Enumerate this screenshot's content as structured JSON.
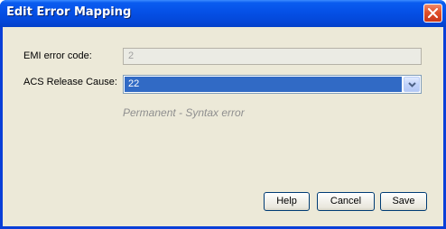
{
  "window": {
    "title": "Edit Error Mapping"
  },
  "form": {
    "emi_label": "EMI error code:",
    "emi_value": "2",
    "acs_label": "ACS Release Cause:",
    "acs_value": "22",
    "cause_description": "Permanent - Syntax error"
  },
  "buttons": {
    "help": "Help",
    "cancel": "Cancel",
    "save": "Save"
  },
  "icons": {
    "close": "close-icon",
    "dropdown": "chevron-down-icon"
  },
  "colors": {
    "title_bar": "#0550e6",
    "client_bg": "#ece9d8",
    "selection": "#316ac5",
    "close_button": "#e0502a"
  }
}
